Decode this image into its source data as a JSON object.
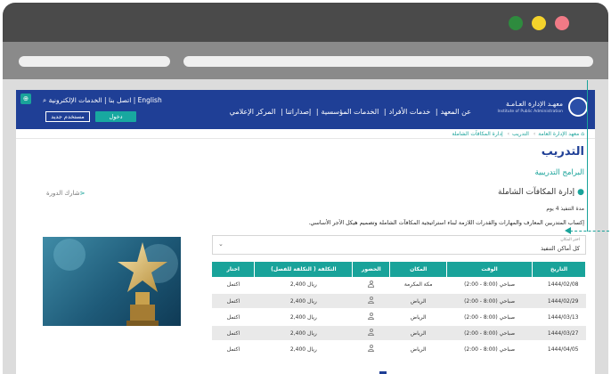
{
  "header": {
    "org_name": "معهـد الإدارة العـامـة",
    "org_sub": "Institute of Public Administration",
    "nav": [
      "عن المعهد",
      "خدمات الأفراد",
      "الخدمات المؤسسية",
      "إصداراتنا",
      "المركز الإعلامي"
    ],
    "top_links": [
      "الخدمات الإلكترونية",
      "اتصل بنا",
      "English"
    ],
    "login": "دخول",
    "new_user": "مستخدم جديد"
  },
  "breadcrumb": [
    "معهد الإدارة العامة",
    "التدريب",
    "إدارة المكافآت الشاملة"
  ],
  "page": {
    "title": "التدريب",
    "subtitle": "البرامج التدريبية",
    "course": "إدارة المكافآت الشاملة",
    "share": "شارك الدورة",
    "duration": "مدة التنفيذ 4 يوم",
    "description": "إكساب المتدربين المعارف والمهارات والقدرات اللازمة لبناء استراتيجية المكافآت الشاملة وتصميم هيكل الأجر الأساسي."
  },
  "filter": {
    "label": "اختر المكان",
    "value": "كل أماكن التنفيذ"
  },
  "table": {
    "headers": [
      "التاريخ",
      "الوقت",
      "المكان",
      "الحضور",
      "التكلفة ( التكلفة للفصل)",
      "اختار"
    ],
    "rows": [
      {
        "date": "1444/02/08",
        "time": "صباحي (8:00 - 2:00)",
        "place": "مكة المكرمة",
        "cost": "2,400 ريال",
        "action": "اكتمل"
      },
      {
        "date": "1444/02/29",
        "time": "صباحي (8:00 - 2:00)",
        "place": "الرياض",
        "cost": "2,400 ريال",
        "action": "اكتمل"
      },
      {
        "date": "1444/03/13",
        "time": "صباحي (8:00 - 2:00)",
        "place": "الرياض",
        "cost": "2,400 ريال",
        "action": "اكتمل"
      },
      {
        "date": "1444/03/27",
        "time": "صباحي (8:00 - 2:00)",
        "place": "الرياض",
        "cost": "2,400 ريال",
        "action": "اكتمل"
      },
      {
        "date": "1444/04/05",
        "time": "صباحي (8:00 - 2:00)",
        "place": "الرياض",
        "cost": "2,400 ريال",
        "action": "اكتمل"
      }
    ]
  },
  "colors": {
    "primary": "#1f3f96",
    "accent": "#19a39a"
  }
}
